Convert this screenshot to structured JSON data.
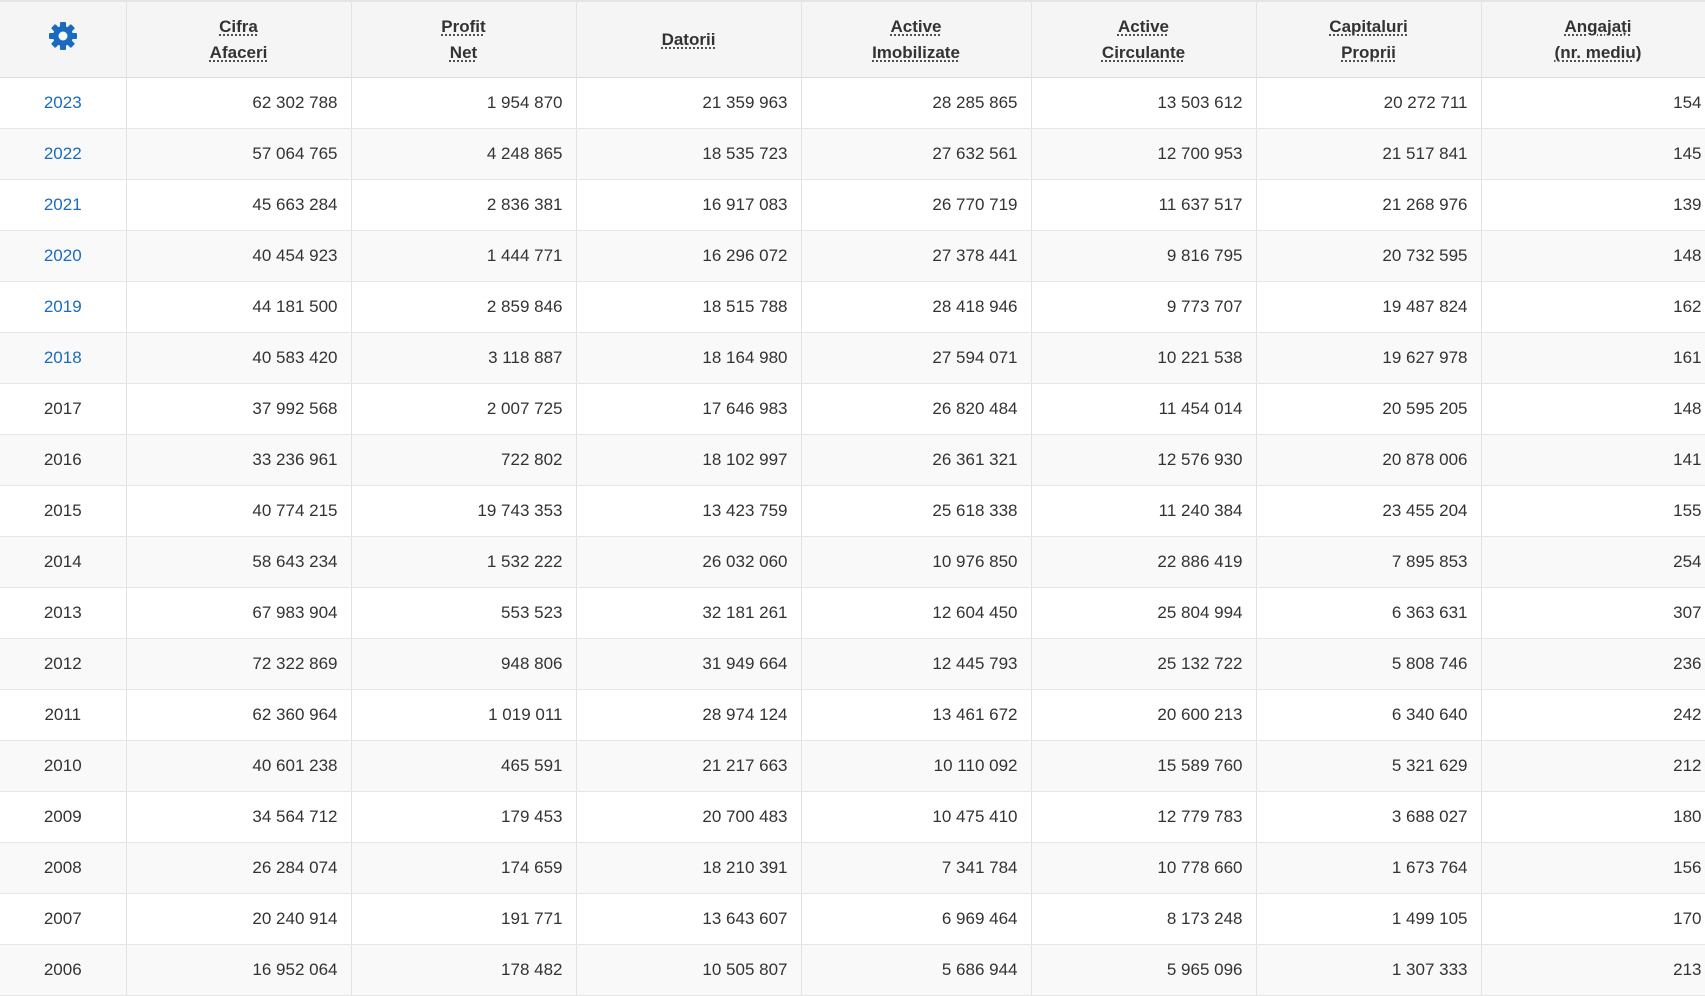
{
  "colors": {
    "accent": "#1a6bc0",
    "header_bg": "#f5f5f5",
    "row_alt": "#f9f9f9"
  },
  "toolbar": {
    "settings_icon": "gear-icon"
  },
  "columns": [
    [
      "Cifra",
      "Afaceri"
    ],
    [
      "Profit",
      "Net"
    ],
    [
      "Datorii"
    ],
    [
      "Active",
      "Imobilizate"
    ],
    [
      "Active",
      "Circulante"
    ],
    [
      "Capitaluri",
      "Proprii"
    ],
    [
      "Angajați",
      "(nr. mediu)"
    ]
  ],
  "rows": [
    {
      "year": "2023",
      "link": true,
      "values": [
        "62 302 788",
        "1 954 870",
        "21 359 963",
        "28 285 865",
        "13 503 612",
        "20 272 711",
        "154"
      ]
    },
    {
      "year": "2022",
      "link": true,
      "values": [
        "57 064 765",
        "4 248 865",
        "18 535 723",
        "27 632 561",
        "12 700 953",
        "21 517 841",
        "145"
      ]
    },
    {
      "year": "2021",
      "link": true,
      "values": [
        "45 663 284",
        "2 836 381",
        "16 917 083",
        "26 770 719",
        "11 637 517",
        "21 268 976",
        "139"
      ]
    },
    {
      "year": "2020",
      "link": true,
      "values": [
        "40 454 923",
        "1 444 771",
        "16 296 072",
        "27 378 441",
        "9 816 795",
        "20 732 595",
        "148"
      ]
    },
    {
      "year": "2019",
      "link": true,
      "values": [
        "44 181 500",
        "2 859 846",
        "18 515 788",
        "28 418 946",
        "9 773 707",
        "19 487 824",
        "162"
      ]
    },
    {
      "year": "2018",
      "link": true,
      "values": [
        "40 583 420",
        "3 118 887",
        "18 164 980",
        "27 594 071",
        "10 221 538",
        "19 627 978",
        "161"
      ]
    },
    {
      "year": "2017",
      "link": false,
      "values": [
        "37 992 568",
        "2 007 725",
        "17 646 983",
        "26 820 484",
        "11 454 014",
        "20 595 205",
        "148"
      ]
    },
    {
      "year": "2016",
      "link": false,
      "values": [
        "33 236 961",
        "722 802",
        "18 102 997",
        "26 361 321",
        "12 576 930",
        "20 878 006",
        "141"
      ]
    },
    {
      "year": "2015",
      "link": false,
      "values": [
        "40 774 215",
        "19 743 353",
        "13 423 759",
        "25 618 338",
        "11 240 384",
        "23 455 204",
        "155"
      ]
    },
    {
      "year": "2014",
      "link": false,
      "values": [
        "58 643 234",
        "1 532 222",
        "26 032 060",
        "10 976 850",
        "22 886 419",
        "7 895 853",
        "254"
      ]
    },
    {
      "year": "2013",
      "link": false,
      "values": [
        "67 983 904",
        "553 523",
        "32 181 261",
        "12 604 450",
        "25 804 994",
        "6 363 631",
        "307"
      ]
    },
    {
      "year": "2012",
      "link": false,
      "values": [
        "72 322 869",
        "948 806",
        "31 949 664",
        "12 445 793",
        "25 132 722",
        "5 808 746",
        "236"
      ]
    },
    {
      "year": "2011",
      "link": false,
      "values": [
        "62 360 964",
        "1 019 011",
        "28 974 124",
        "13 461 672",
        "20 600 213",
        "6 340 640",
        "242"
      ]
    },
    {
      "year": "2010",
      "link": false,
      "values": [
        "40 601 238",
        "465 591",
        "21 217 663",
        "10 110 092",
        "15 589 760",
        "5 321 629",
        "212"
      ]
    },
    {
      "year": "2009",
      "link": false,
      "values": [
        "34 564 712",
        "179 453",
        "20 700 483",
        "10 475 410",
        "12 779 783",
        "3 688 027",
        "180"
      ]
    },
    {
      "year": "2008",
      "link": false,
      "values": [
        "26 284 074",
        "174 659",
        "18 210 391",
        "7 341 784",
        "10 778 660",
        "1 673 764",
        "156"
      ]
    },
    {
      "year": "2007",
      "link": false,
      "values": [
        "20 240 914",
        "191 771",
        "13 643 607",
        "6 969 464",
        "8 173 248",
        "1 499 105",
        "170"
      ]
    },
    {
      "year": "2006",
      "link": false,
      "values": [
        "16 952 064",
        "178 482",
        "10 505 807",
        "5 686 944",
        "5 965 096",
        "1 307 333",
        "213"
      ]
    }
  ]
}
